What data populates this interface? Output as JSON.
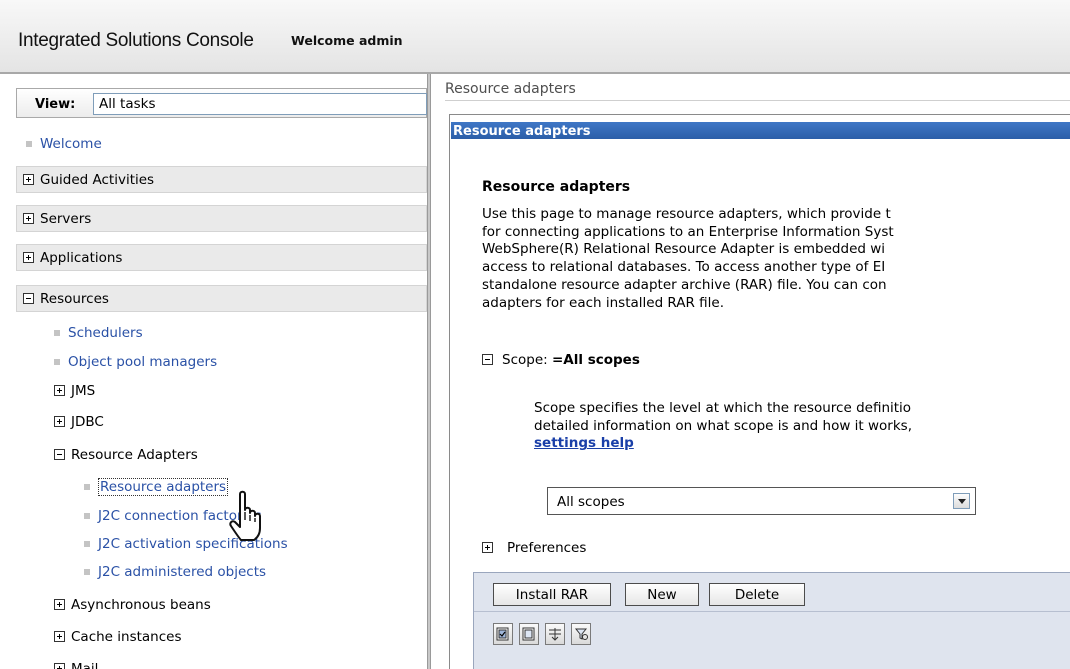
{
  "banner": {
    "title": "Integrated Solutions Console",
    "welcome": "Welcome admin"
  },
  "nav": {
    "view_label": "View:",
    "view_value": "All tasks",
    "welcome_link": "Welcome",
    "sections": {
      "guided": "Guided Activities",
      "servers": "Servers",
      "applications": "Applications",
      "resources": "Resources"
    },
    "resources_items": {
      "schedulers": "Schedulers",
      "object_pool": "Object pool managers",
      "jms": "JMS",
      "jdbc": "JDBC",
      "resource_adapters_group": "Resource Adapters",
      "resource_adapters": "Resource adapters",
      "j2c_cf": "J2C connection factories",
      "j2c_as": "J2C activation specifications",
      "j2c_ao": "J2C administered objects",
      "async_beans": "Asynchronous beans",
      "cache": "Cache instances",
      "mail": "Mail"
    }
  },
  "content": {
    "breadcrumb": "Resource adapters",
    "panel_title": "Resource adapters",
    "heading": "Resource adapters",
    "description_lines": [
      "Use this page to manage resource adapters, which provide t",
      "for connecting applications to an Enterprise Information Syst",
      "WebSphere(R) Relational Resource Adapter is embedded wi",
      "access to relational databases. To access another type of EI",
      "standalone resource adapter archive (RAR) file. You can con",
      "adapters for each installed RAR file."
    ],
    "scope_label": "Scope:",
    "scope_value": "=All scopes",
    "scope_desc_lines": [
      "Scope specifies the level at which the resource definitio",
      "detailed information on what scope is and how it works,"
    ],
    "scope_help_link": "settings help",
    "scope_select_value": "All scopes",
    "preferences": "Preferences",
    "buttons": {
      "install": "Install RAR",
      "new": "New",
      "delete": "Delete"
    },
    "icon_buttons": [
      "select-all-icon",
      "deselect-all-icon",
      "show-filter-icon",
      "hide-filter-icon"
    ]
  },
  "colors": {
    "panel_header": "#2b5ea8",
    "link": "#2a51a6",
    "section_bg": "#eaeaea"
  }
}
